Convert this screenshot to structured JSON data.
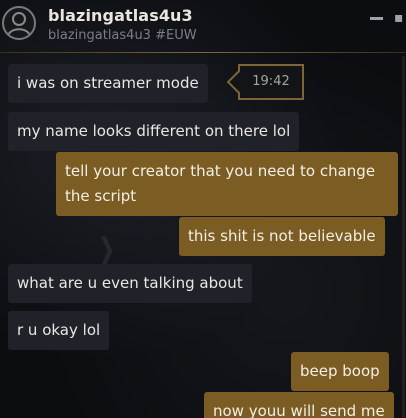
{
  "header": {
    "name": "blazingatlas4u3",
    "subtitle": "blazingatlas4u3 #EUW"
  },
  "messages": [
    {
      "direction": "in",
      "text": "i was on streamer mode"
    },
    {
      "direction": "in",
      "text": "my name looks different on there lol"
    },
    {
      "direction": "out",
      "text": "tell your creator that you need to change the script"
    },
    {
      "direction": "out",
      "text": "this shit is not believable"
    },
    {
      "direction": "in",
      "text": "what are u even talking about"
    },
    {
      "direction": "in",
      "text": "r u okay lol"
    },
    {
      "direction": "out",
      "text": "beep boop"
    },
    {
      "direction": "out",
      "text": "now youu will send me"
    }
  ],
  "hover_timestamp": "19:42",
  "colors": {
    "incoming_bubble": "#1f2329",
    "outgoing_bubble": "#7b5d24",
    "accent_gold": "#7c6537",
    "background": "#0b0d11"
  },
  "icons": {
    "avatar": "user-avatar-placeholder",
    "minimize": "minimize-icon",
    "more": "more-icon"
  }
}
